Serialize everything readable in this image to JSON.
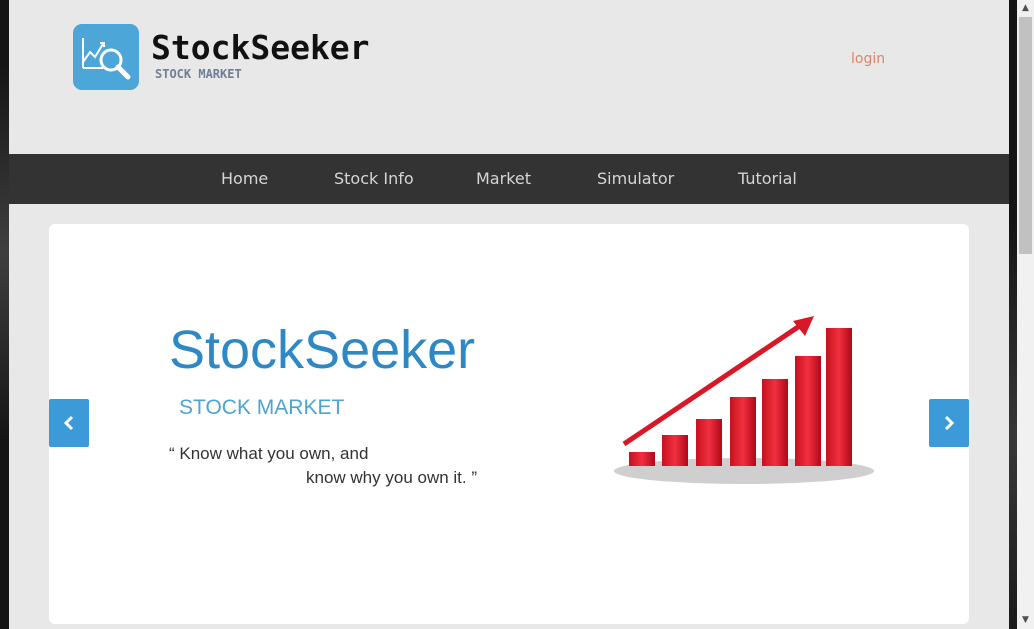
{
  "header": {
    "brand_name": "StockSeeker",
    "brand_subtitle": "STOCK MARKET",
    "login_label": "login"
  },
  "nav": {
    "items": [
      {
        "label": "Home"
      },
      {
        "label": "Stock Info"
      },
      {
        "label": "Market"
      },
      {
        "label": "Simulator"
      },
      {
        "label": "Tutorial"
      }
    ]
  },
  "slider": {
    "title": "StockSeeker",
    "subtitle": "STOCK MARKET",
    "quote_line1": "“ Know what you own, and",
    "quote_line2": "know why you own it. ”",
    "prev_icon": "chevron-left-icon",
    "next_icon": "chevron-right-icon"
  },
  "colors": {
    "accent": "#3d9ad8",
    "nav_bg": "#333333",
    "page_bg": "#e8e8e8",
    "login": "#d9866a",
    "bar_red": "#e0202e"
  }
}
